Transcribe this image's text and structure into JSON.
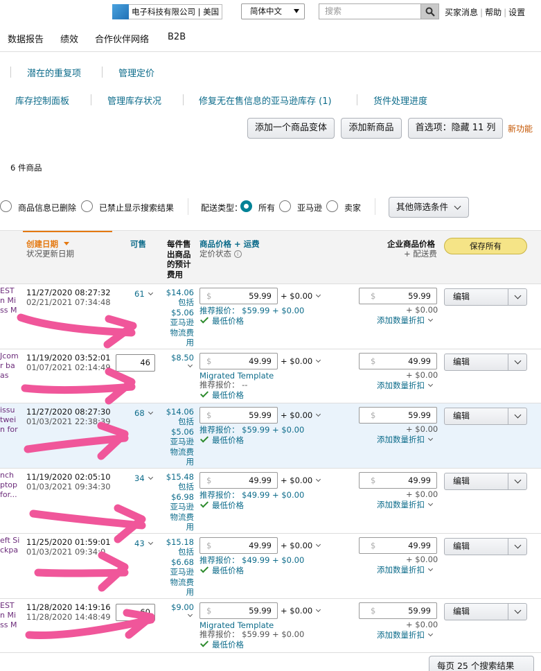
{
  "header": {
    "store": "电子科技有限公司 | 美国",
    "language": "简体中文",
    "search_placeholder": "搜索",
    "links": [
      "买家消息",
      "帮助",
      "设置"
    ]
  },
  "nav": [
    "数据报告",
    "绩效",
    "合作伙伴网络",
    "B2B"
  ],
  "subnav": {
    "row1": [
      "潜在的重复项",
      "管理定价"
    ],
    "row2": [
      "库存控制面板",
      "管理库存状况",
      "修复无在售信息的亚马逊库存 (1)",
      "货件处理进度"
    ]
  },
  "actions": {
    "add_variation": "添加一个商品变体",
    "add_product": "添加新商品",
    "preferences": "首选项：隐藏 11 列",
    "new_feature": "新功能"
  },
  "item_count": "6 件商品",
  "filters": {
    "deleted": "商品信息已删除",
    "suppressed": "已禁止显示搜索结果",
    "fulfillment_label": "配送类型：",
    "all": "所有",
    "amazon": "亚马逊",
    "seller": "卖家",
    "more": "其他筛选条件"
  },
  "columns": {
    "created": "创建日期",
    "status_updated": "状况更新日期",
    "available": "可售",
    "fee": "每件售出商品的预计费用",
    "price": "商品价格 + 运费",
    "price_status": "定价状态",
    "business_price": "企业商品价格",
    "business_shipping": "+ 配送费",
    "save_all": "保存所有"
  },
  "rows": [
    {
      "title": "EST\nn Mi\nss M",
      "created": "11/27/2020 08:27:32",
      "updated": "02/21/2021 07:34:48",
      "available": "61",
      "fee": "$14.06\n包括\n$5.06\n亚马逊\n物流费\n用",
      "price": "59.99",
      "shipping": "+ $0.00",
      "reference": "推荐报价： $59.99 + $0.00",
      "lowest": "最低价格",
      "biz_price": "59.99",
      "biz_shipping": "+ $0.00",
      "qty_discount": "添加数量折扣",
      "edit": "编辑"
    },
    {
      "title": "Jcom\nr ba\nas",
      "created": "11/19/2020 03:52:01",
      "updated": "01/07/2021 02:14:49",
      "available": "46",
      "fee": "$8.50",
      "price": "49.99",
      "shipping": "+ $0.00",
      "template": "Migrated Template",
      "reference": "推荐报价： --",
      "lowest": "最低价格",
      "biz_price": "49.99",
      "biz_shipping": "+ $0.00",
      "qty_discount": "添加数量折扣",
      "edit": "编辑"
    },
    {
      "title": "issu\ntwei\nn for",
      "created": "11/27/2020 08:27:30",
      "updated": "01/03/2021 22:38:39",
      "available": "68",
      "fee": "$14.06\n包括\n$5.06\n亚马逊\n物流费\n用",
      "price": "59.99",
      "shipping": "+ $0.00",
      "reference": "推荐报价： $59.99 + $0.00",
      "lowest": "最低价格",
      "biz_price": "59.99",
      "biz_shipping": "+ $0.00",
      "qty_discount": "添加数量折扣",
      "edit": "编辑"
    },
    {
      "title": "nch\nptop\nfor...",
      "created": "11/19/2020 02:05:10",
      "updated": "01/03/2021 09:34:30",
      "available": "34",
      "fee": "$15.48\n包括\n$6.98\n亚马逊\n物流费\n用",
      "price": "49.99",
      "shipping": "+ $0.00",
      "reference": "推荐报价： $49.99 + $0.00",
      "lowest": "最低价格",
      "biz_price": "49.99",
      "biz_shipping": "+ $0.00",
      "qty_discount": "添加数量折扣",
      "edit": "编辑"
    },
    {
      "title": "eft Si\nckpa",
      "created": "11/25/2020 01:59:01",
      "updated": "01/03/2021 09:34:0",
      "available": "43",
      "fee": "$15.18\n包括\n$6.68\n亚马逊\n物流费\n用",
      "price": "49.99",
      "shipping": "+ $0.00",
      "reference": "推荐报价： $49.99 + $0.00",
      "lowest": "最低价格",
      "biz_price": "49.99",
      "biz_shipping": "+ $0.00",
      "qty_discount": "添加数量折扣",
      "edit": "编辑"
    },
    {
      "title": "EST\nn Mi\nss M",
      "created": "11/28/2020 14:19:16",
      "updated": "11/28/2020 14:48:49",
      "available": "60",
      "fee": "$9.00",
      "price": "59.99",
      "shipping": "+ $0.00",
      "template": "Migrated Template",
      "reference": "推荐报价： $59.99 + $0.00",
      "lowest": "最低价格",
      "biz_price": "59.99",
      "biz_shipping": "+ $0.00",
      "qty_discount": "添加数量折扣",
      "edit": "编辑"
    }
  ],
  "pagination": "每页 25 个搜索结果",
  "colors": {
    "link": "#0c6b8a",
    "accent_orange": "#e47911",
    "save_yellow": "#f5e487",
    "annotation_arrow": "#f0569a"
  }
}
